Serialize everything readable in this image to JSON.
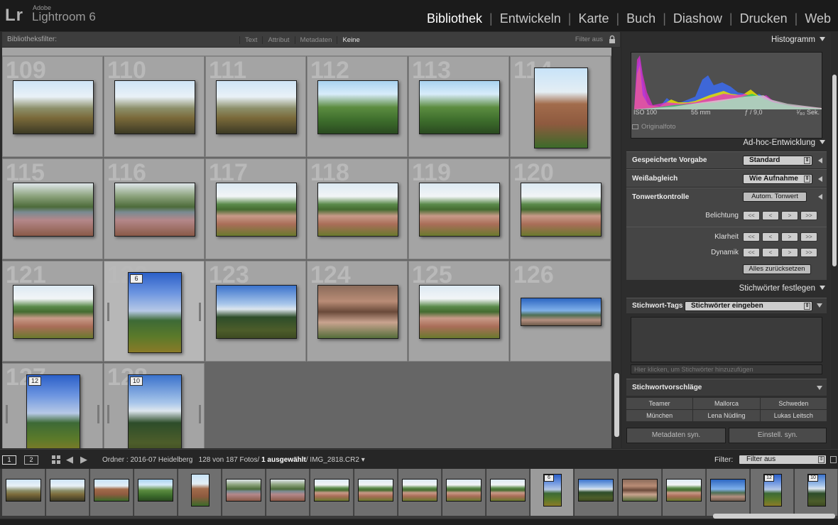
{
  "app": {
    "logo": "Lr",
    "brand_small": "Adobe",
    "brand_main": "Lightroom 6"
  },
  "modules": [
    "Bibliothek",
    "Entwickeln",
    "Karte",
    "Buch",
    "Diashow",
    "Drucken",
    "Web"
  ],
  "active_module": "Bibliothek",
  "filterbar": {
    "label": "Bibliotheksfilter:",
    "options": [
      "Text",
      "Attribut",
      "Metadaten",
      "Keine"
    ],
    "active": "Keine",
    "filter_off": "Filter aus"
  },
  "grid": {
    "cells": [
      {
        "num": "109",
        "img": "p-park",
        "orient": "land"
      },
      {
        "num": "110",
        "img": "p-park",
        "orient": "land"
      },
      {
        "num": "111",
        "img": "p-park",
        "orient": "land"
      },
      {
        "num": "112",
        "img": "p-tower",
        "orient": "land"
      },
      {
        "num": "113",
        "img": "p-tower",
        "orient": "land"
      },
      {
        "num": "114",
        "img": "p-ruin",
        "orient": "port"
      },
      {
        "num": "115",
        "img": "p-river",
        "orient": "land"
      },
      {
        "num": "116",
        "img": "p-river",
        "orient": "land"
      },
      {
        "num": "117",
        "img": "p-town",
        "orient": "land"
      },
      {
        "num": "118",
        "img": "p-town",
        "orient": "land"
      },
      {
        "num": "119",
        "img": "p-town",
        "orient": "land"
      },
      {
        "num": "120",
        "img": "p-town",
        "orient": "land"
      },
      {
        "num": "121",
        "img": "p-town",
        "orient": "land"
      },
      {
        "num": "122",
        "img": "p-tall",
        "orient": "port",
        "badge": "6"
      },
      {
        "num": "123",
        "img": "p-valley",
        "orient": "land"
      },
      {
        "num": "124",
        "img": "p-roof",
        "orient": "land"
      },
      {
        "num": "125",
        "img": "p-town",
        "orient": "land"
      },
      {
        "num": "126",
        "img": "p-pano",
        "orient": "pano"
      },
      {
        "num": "127",
        "img": "p-tall",
        "orient": "port",
        "badge": "12"
      },
      {
        "num": "128",
        "img": "p-valley",
        "orient": "port",
        "badge": "10"
      }
    ]
  },
  "histogram": {
    "title": "Histogramm",
    "iso": "ISO 100",
    "focal": "55 mm",
    "aperture": "ƒ / 9,0",
    "shutter": "¹⁄₈₀ Sek.",
    "original": "Originalfoto"
  },
  "quick_develop": {
    "title": "Ad-hoc-Entwicklung",
    "preset_label": "Gespeicherte Vorgabe",
    "preset_value": "Standard",
    "wb_label": "Weißabgleich",
    "wb_value": "Wie Aufnahme",
    "tone_label": "Tonwertkontrolle",
    "auto_tone": "Autom. Tonwert",
    "exposure": "Belichtung",
    "clarity": "Klarheit",
    "vibrance": "Dynamik",
    "step_glyphs": [
      "<<",
      "<",
      ">",
      ">>"
    ],
    "reset": "Alles zurücksetzen"
  },
  "keywording": {
    "title": "Stichwörter festlegen",
    "tags_label": "Stichwort-Tags",
    "tags_value": "Stichwörter eingeben",
    "hint": "Hier klicken, um Stichwörter hinzuzufügen",
    "suggestions_title": "Stichwortvorschläge",
    "suggestions": [
      "Teamer",
      "Mallorca",
      "Schweden",
      "München",
      "Lena Nüdling",
      "Lukas Leitsch"
    ]
  },
  "panel_buttons": {
    "sync_meta": "Metadaten syn.",
    "sync_settings": "Einstell. syn."
  },
  "bottombar": {
    "page1": "1",
    "page2": "2",
    "folder": "Ordner : 2016-07 Heidelberg",
    "count": "128 von 187 Fotos/",
    "selected": "1 ausgewählt",
    "filename": "/ IMG_2818.CR2",
    "filter_label": "Filter:",
    "filter_value": "Filter aus"
  },
  "filmstrip": [
    {
      "img": "p-park"
    },
    {
      "img": "p-park"
    },
    {
      "img": "p-ruin"
    },
    {
      "img": "p-tower"
    },
    {
      "img": "p-ruin",
      "orient": "port"
    },
    {
      "img": "p-river"
    },
    {
      "img": "p-river"
    },
    {
      "img": "p-town"
    },
    {
      "img": "p-town"
    },
    {
      "img": "p-town"
    },
    {
      "img": "p-town"
    },
    {
      "img": "p-town"
    },
    {
      "img": "p-tall",
      "orient": "port",
      "badge": "6",
      "sel": true
    },
    {
      "img": "p-valley"
    },
    {
      "img": "p-roof"
    },
    {
      "img": "p-town"
    },
    {
      "img": "p-pano"
    },
    {
      "img": "p-tall",
      "orient": "port",
      "badge": "12"
    },
    {
      "img": "p-valley",
      "orient": "port",
      "badge": "10"
    }
  ]
}
